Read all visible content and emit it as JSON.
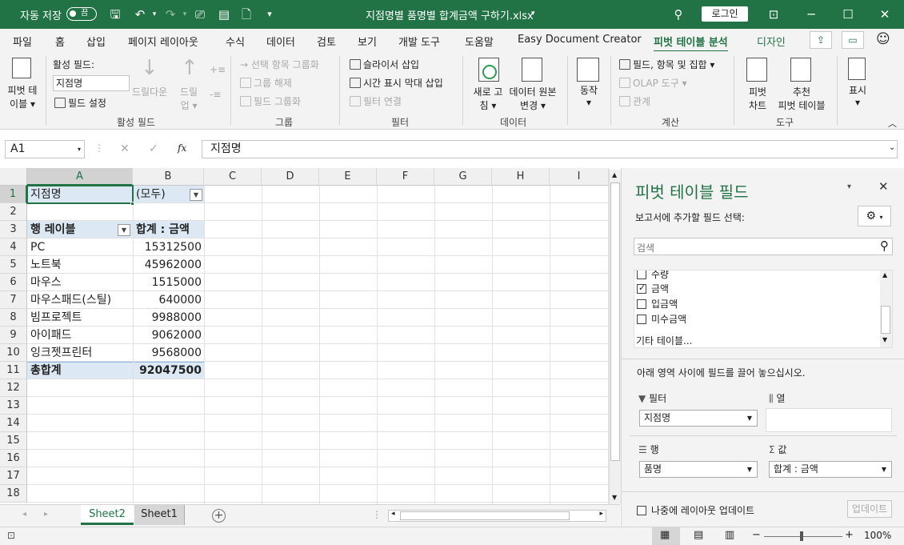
{
  "title_bar": {
    "autosave_label": "자동 저장",
    "autosave_state": "끔",
    "filename": "지점명별 품명별 합계금액 구하기.xlsx",
    "login_label": "로그인"
  },
  "tabs": [
    "파일",
    "홈",
    "삽입",
    "페이지 레이아웃",
    "수식",
    "데이터",
    "검토",
    "보기",
    "개발 도구",
    "도움말",
    "Easy Document Creator",
    "피벗 테이블 분석",
    "디자인"
  ],
  "active_tab": "피벗 테이블 분석",
  "ribbon": {
    "pivot_table_label_1": "피벗 테",
    "pivot_table_label_2": "이블",
    "active_field_label": "활성 필드:",
    "active_field_value": "지점명",
    "drill_down": "드릴다운",
    "drill_up_1": "드릴",
    "drill_up_2": "업",
    "field_settings": "필드 설정",
    "group_active_field": "활성 필드",
    "group_selection": "선택 항목 그룹화",
    "ungroup": "그룹 해제",
    "group_field": "필드 그룹화",
    "group_group": "그룹",
    "insert_slicer": "슬라이서 삽입",
    "insert_timeline": "시간 표시 막대 삽입",
    "filter_connections": "필터 연결",
    "group_filter": "필터",
    "refresh_1": "새로 고",
    "refresh_2": "침",
    "change_source_1": "데이터 원본",
    "change_source_2": "변경",
    "group_data": "데이터",
    "actions": "동작",
    "fields_items_sets": "필드, 항목 및 집합",
    "olap_tools": "OLAP 도구",
    "relationships": "관계",
    "group_calc": "계산",
    "pivot_chart_1": "피벗",
    "pivot_chart_2": "차트",
    "recommended_1": "추천",
    "recommended_2": "피벗 테이블",
    "group_tools": "도구",
    "show": "표시"
  },
  "formula_bar": {
    "name_box": "A1",
    "fx": "fx",
    "content": "지점명"
  },
  "columns": [
    "A",
    "B",
    "C",
    "D",
    "E",
    "F",
    "G",
    "H",
    "I"
  ],
  "rows": [
    "1",
    "2",
    "3",
    "4",
    "5",
    "6",
    "7",
    "8",
    "9",
    "10",
    "11",
    "12",
    "13",
    "14",
    "15",
    "16",
    "17",
    "18"
  ],
  "sheet": {
    "filter_label": "지점명",
    "filter_value": "(모두)",
    "row_labels_header": "행 레이블",
    "sum_header": "합계 : 금액",
    "items": [
      {
        "name": "PC",
        "value": "15312500"
      },
      {
        "name": "노트북",
        "value": "45962000"
      },
      {
        "name": "마우스",
        "value": "1515000"
      },
      {
        "name": "마우스패드(스틸)",
        "value": "640000"
      },
      {
        "name": "빔프로젝트",
        "value": "9988000"
      },
      {
        "name": "아이패드",
        "value": "9062000"
      },
      {
        "name": "잉크젯프린터",
        "value": "9568000"
      }
    ],
    "grand_total_label": "총합계",
    "grand_total_value": "92047500"
  },
  "sheet_tabs": [
    {
      "name": "Sheet2",
      "active": true
    },
    {
      "name": "Sheet1",
      "active": false
    }
  ],
  "status_bar": {
    "zoom": "100%"
  },
  "pivot_pane": {
    "title": "피벗 테이블 필드",
    "subtitle": "보고서에 추가할 필드 선택:",
    "search_placeholder": "검색",
    "fields": [
      {
        "name": "수량",
        "checked": false
      },
      {
        "name": "금액",
        "checked": true
      },
      {
        "name": "입금액",
        "checked": false
      },
      {
        "name": "미수금액",
        "checked": false
      }
    ],
    "more_tables": "기타 테이블...",
    "drag_hint": "아래 영역 사이에 필드를 끌어 놓으십시오.",
    "area_filter": "필터",
    "area_columns": "열",
    "area_rows": "행",
    "area_values": "값",
    "filter_field": "지점명",
    "row_field": "품명",
    "value_field": "합계 : 금액",
    "defer_update": "나중에 레이아웃 업데이트",
    "update_button": "업데이트"
  }
}
